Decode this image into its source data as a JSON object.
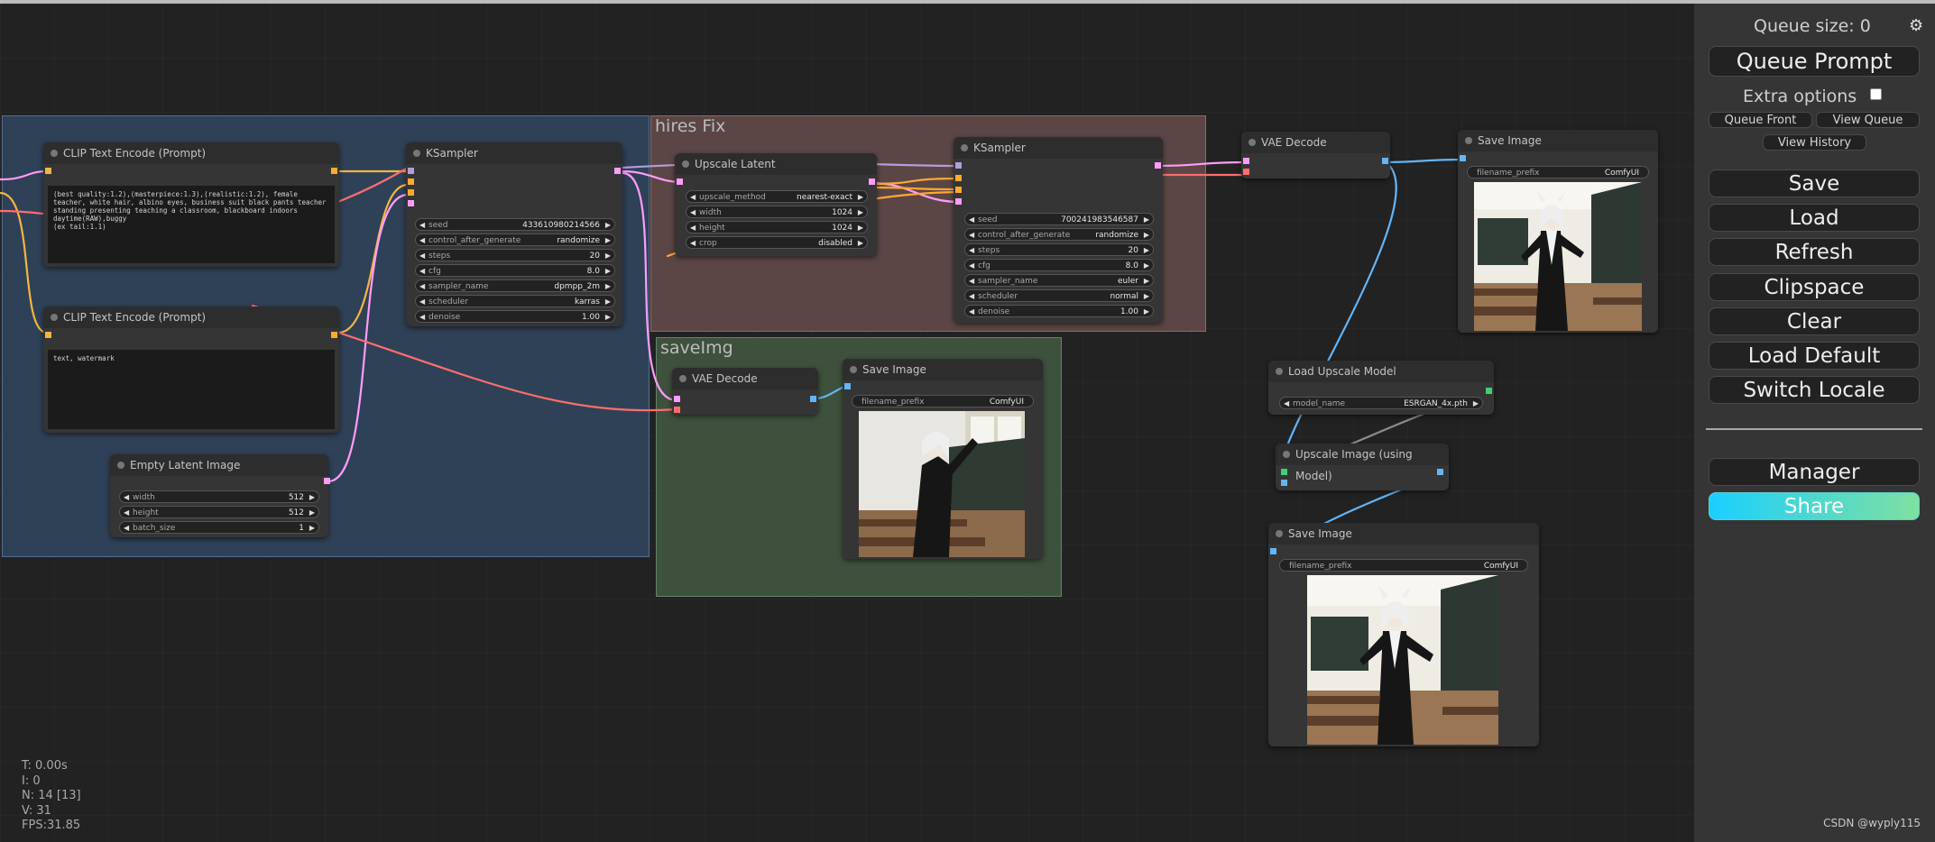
{
  "colors": {
    "wire_clip": "#f2b544",
    "wire_conditioning": "#ffa931",
    "wire_latent": "#ff9cf9",
    "wire_model": "#b39ddb",
    "wire_vae": "#ff6e6e",
    "wire_image": "#64b5f6",
    "wire_upscale": "#8a8a8a",
    "share_gradient_start": "#1ad0ff",
    "share_gradient_end": "#7fe0a0"
  },
  "groups": {
    "hires": "hires Fix",
    "saveimg": "saveImg"
  },
  "nodes": {
    "clip_pos": {
      "title": "CLIP Text Encode (Prompt)",
      "text": "(best quality:1.2),(masterpiece:1.3),(realistic:1.2), female teacher, white hair, albino eyes, business suit black pants teacher standing presenting teaching a classroom, blackboard indoors daytime(RAW),buggy\n(ex tail:1.1)"
    },
    "clip_neg": {
      "title": "CLIP Text Encode (Prompt)",
      "text": "text, watermark"
    },
    "empty_latent": {
      "title": "Empty Latent Image",
      "widgets": [
        {
          "name": "width",
          "value": "512"
        },
        {
          "name": "height",
          "value": "512"
        },
        {
          "name": "batch_size",
          "value": "1"
        }
      ]
    },
    "ksampler1": {
      "title": "KSampler",
      "widgets": [
        {
          "name": "seed",
          "value": "433610980214566"
        },
        {
          "name": "control_after_generate",
          "value": "randomize"
        },
        {
          "name": "steps",
          "value": "20"
        },
        {
          "name": "cfg",
          "value": "8.0"
        },
        {
          "name": "sampler_name",
          "value": "dpmpp_2m"
        },
        {
          "name": "scheduler",
          "value": "karras"
        },
        {
          "name": "denoise",
          "value": "1.00"
        }
      ]
    },
    "upscale_latent": {
      "title": "Upscale Latent",
      "widgets": [
        {
          "name": "upscale_method",
          "value": "nearest-exact"
        },
        {
          "name": "width",
          "value": "1024"
        },
        {
          "name": "height",
          "value": "1024"
        },
        {
          "name": "crop",
          "value": "disabled"
        }
      ]
    },
    "ksampler2": {
      "title": "KSampler",
      "widgets": [
        {
          "name": "seed",
          "value": "700241983546587"
        },
        {
          "name": "control_after_generate",
          "value": "randomize"
        },
        {
          "name": "steps",
          "value": "20"
        },
        {
          "name": "cfg",
          "value": "8.0"
        },
        {
          "name": "sampler_name",
          "value": "euler"
        },
        {
          "name": "scheduler",
          "value": "normal"
        },
        {
          "name": "denoise",
          "value": "1.00"
        }
      ]
    },
    "vae_decode1": {
      "title": "VAE Decode"
    },
    "vae_decode2": {
      "title": "VAE Decode"
    },
    "save_image1": {
      "title": "Save Image",
      "prefix_name": "filename_prefix",
      "prefix_value": "ComfyUI"
    },
    "save_image2": {
      "title": "Save Image",
      "prefix_name": "filename_prefix",
      "prefix_value": "ComfyUI"
    },
    "save_image3": {
      "title": "Save Image",
      "prefix_name": "filename_prefix",
      "prefix_value": "ComfyUI"
    },
    "load_upscale": {
      "title": "Load Upscale Model",
      "widget_name": "model_name",
      "widget_value": "ESRGAN_4x.pth"
    },
    "upscale_image": {
      "title": "Upscale Image (using Model)"
    }
  },
  "stats": {
    "t": "T: 0.00s",
    "i": "I: 0",
    "n": "N: 14 [13]",
    "v": "V: 31",
    "fps": "FPS:31.85"
  },
  "sidebar": {
    "queue_size": "Queue size: 0",
    "queue_prompt": "Queue Prompt",
    "extra_options": "Extra options",
    "queue_front": "Queue Front",
    "view_queue": "View Queue",
    "view_history": "View History",
    "save": "Save",
    "load": "Load",
    "refresh": "Refresh",
    "clipspace": "Clipspace",
    "clear": "Clear",
    "load_default": "Load Default",
    "switch_locale": "Switch Locale",
    "manager": "Manager",
    "share": "Share",
    "watermark": "CSDN @wyply115",
    "settings_icon": "gear-icon"
  }
}
